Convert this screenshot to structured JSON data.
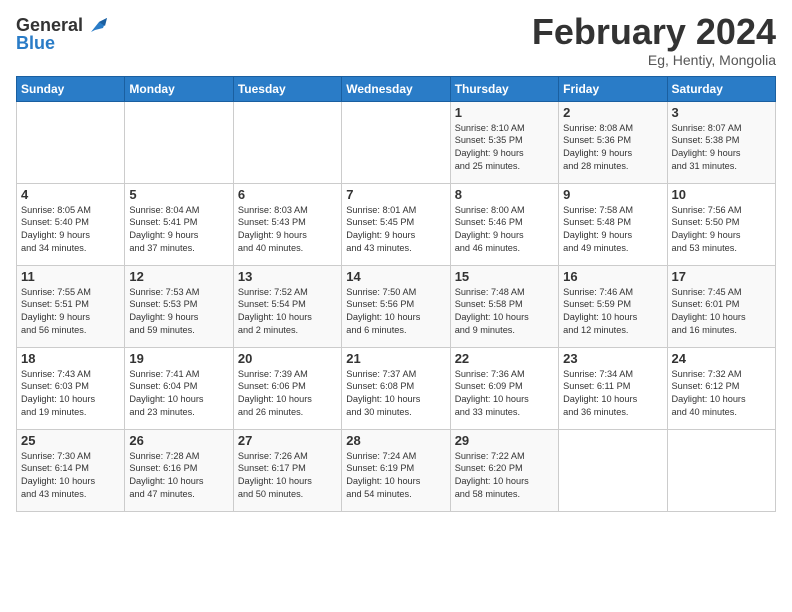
{
  "header": {
    "logo_general": "General",
    "logo_blue": "Blue",
    "month_title": "February 2024",
    "location": "Eg, Hentiy, Mongolia"
  },
  "days_of_week": [
    "Sunday",
    "Monday",
    "Tuesday",
    "Wednesday",
    "Thursday",
    "Friday",
    "Saturday"
  ],
  "weeks": [
    [
      {
        "num": "",
        "info": ""
      },
      {
        "num": "",
        "info": ""
      },
      {
        "num": "",
        "info": ""
      },
      {
        "num": "",
        "info": ""
      },
      {
        "num": "1",
        "info": "Sunrise: 8:10 AM\nSunset: 5:35 PM\nDaylight: 9 hours\nand 25 minutes."
      },
      {
        "num": "2",
        "info": "Sunrise: 8:08 AM\nSunset: 5:36 PM\nDaylight: 9 hours\nand 28 minutes."
      },
      {
        "num": "3",
        "info": "Sunrise: 8:07 AM\nSunset: 5:38 PM\nDaylight: 9 hours\nand 31 minutes."
      }
    ],
    [
      {
        "num": "4",
        "info": "Sunrise: 8:05 AM\nSunset: 5:40 PM\nDaylight: 9 hours\nand 34 minutes."
      },
      {
        "num": "5",
        "info": "Sunrise: 8:04 AM\nSunset: 5:41 PM\nDaylight: 9 hours\nand 37 minutes."
      },
      {
        "num": "6",
        "info": "Sunrise: 8:03 AM\nSunset: 5:43 PM\nDaylight: 9 hours\nand 40 minutes."
      },
      {
        "num": "7",
        "info": "Sunrise: 8:01 AM\nSunset: 5:45 PM\nDaylight: 9 hours\nand 43 minutes."
      },
      {
        "num": "8",
        "info": "Sunrise: 8:00 AM\nSunset: 5:46 PM\nDaylight: 9 hours\nand 46 minutes."
      },
      {
        "num": "9",
        "info": "Sunrise: 7:58 AM\nSunset: 5:48 PM\nDaylight: 9 hours\nand 49 minutes."
      },
      {
        "num": "10",
        "info": "Sunrise: 7:56 AM\nSunset: 5:50 PM\nDaylight: 9 hours\nand 53 minutes."
      }
    ],
    [
      {
        "num": "11",
        "info": "Sunrise: 7:55 AM\nSunset: 5:51 PM\nDaylight: 9 hours\nand 56 minutes."
      },
      {
        "num": "12",
        "info": "Sunrise: 7:53 AM\nSunset: 5:53 PM\nDaylight: 9 hours\nand 59 minutes."
      },
      {
        "num": "13",
        "info": "Sunrise: 7:52 AM\nSunset: 5:54 PM\nDaylight: 10 hours\nand 2 minutes."
      },
      {
        "num": "14",
        "info": "Sunrise: 7:50 AM\nSunset: 5:56 PM\nDaylight: 10 hours\nand 6 minutes."
      },
      {
        "num": "15",
        "info": "Sunrise: 7:48 AM\nSunset: 5:58 PM\nDaylight: 10 hours\nand 9 minutes."
      },
      {
        "num": "16",
        "info": "Sunrise: 7:46 AM\nSunset: 5:59 PM\nDaylight: 10 hours\nand 12 minutes."
      },
      {
        "num": "17",
        "info": "Sunrise: 7:45 AM\nSunset: 6:01 PM\nDaylight: 10 hours\nand 16 minutes."
      }
    ],
    [
      {
        "num": "18",
        "info": "Sunrise: 7:43 AM\nSunset: 6:03 PM\nDaylight: 10 hours\nand 19 minutes."
      },
      {
        "num": "19",
        "info": "Sunrise: 7:41 AM\nSunset: 6:04 PM\nDaylight: 10 hours\nand 23 minutes."
      },
      {
        "num": "20",
        "info": "Sunrise: 7:39 AM\nSunset: 6:06 PM\nDaylight: 10 hours\nand 26 minutes."
      },
      {
        "num": "21",
        "info": "Sunrise: 7:37 AM\nSunset: 6:08 PM\nDaylight: 10 hours\nand 30 minutes."
      },
      {
        "num": "22",
        "info": "Sunrise: 7:36 AM\nSunset: 6:09 PM\nDaylight: 10 hours\nand 33 minutes."
      },
      {
        "num": "23",
        "info": "Sunrise: 7:34 AM\nSunset: 6:11 PM\nDaylight: 10 hours\nand 36 minutes."
      },
      {
        "num": "24",
        "info": "Sunrise: 7:32 AM\nSunset: 6:12 PM\nDaylight: 10 hours\nand 40 minutes."
      }
    ],
    [
      {
        "num": "25",
        "info": "Sunrise: 7:30 AM\nSunset: 6:14 PM\nDaylight: 10 hours\nand 43 minutes."
      },
      {
        "num": "26",
        "info": "Sunrise: 7:28 AM\nSunset: 6:16 PM\nDaylight: 10 hours\nand 47 minutes."
      },
      {
        "num": "27",
        "info": "Sunrise: 7:26 AM\nSunset: 6:17 PM\nDaylight: 10 hours\nand 50 minutes."
      },
      {
        "num": "28",
        "info": "Sunrise: 7:24 AM\nSunset: 6:19 PM\nDaylight: 10 hours\nand 54 minutes."
      },
      {
        "num": "29",
        "info": "Sunrise: 7:22 AM\nSunset: 6:20 PM\nDaylight: 10 hours\nand 58 minutes."
      },
      {
        "num": "",
        "info": ""
      },
      {
        "num": "",
        "info": ""
      }
    ]
  ]
}
